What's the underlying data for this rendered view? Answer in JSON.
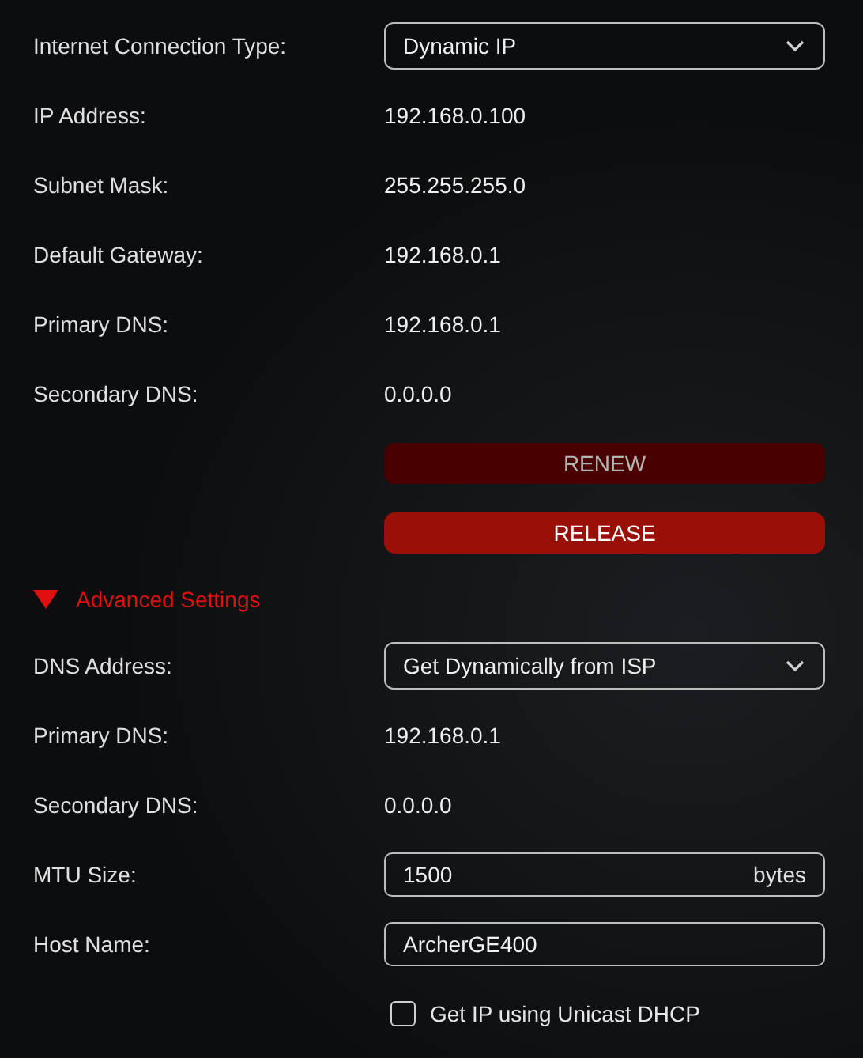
{
  "connection_type": {
    "label": "Internet Connection Type:",
    "value": "Dynamic IP"
  },
  "info_rows": [
    {
      "label": "IP Address:",
      "value": "192.168.0.100"
    },
    {
      "label": "Subnet Mask:",
      "value": "255.255.255.0"
    },
    {
      "label": "Default Gateway:",
      "value": "192.168.0.1"
    },
    {
      "label": "Primary DNS:",
      "value": "192.168.0.1"
    },
    {
      "label": "Secondary DNS:",
      "value": "0.0.0.0"
    }
  ],
  "buttons": [
    {
      "label": "RENEW",
      "disabled": true
    },
    {
      "label": "RELEASE",
      "disabled": false
    }
  ],
  "advanced": {
    "label": "Advanced Settings",
    "expanded": true,
    "fields": [
      {
        "kind": "select",
        "label": "DNS Address:",
        "value": "Get Dynamically from ISP"
      },
      {
        "kind": "text",
        "label": "Primary DNS:",
        "value": "192.168.0.1"
      },
      {
        "kind": "text",
        "label": "Secondary DNS:",
        "value": "0.0.0.0"
      },
      {
        "kind": "input",
        "label": "MTU Size:",
        "value": "1500",
        "unit": "bytes"
      },
      {
        "kind": "input",
        "label": "Host Name:",
        "value": "ArcherGE400"
      }
    ],
    "unicast_dhcp": {
      "label": "Get IP using Unicast DHCP",
      "checked": false
    }
  }
}
